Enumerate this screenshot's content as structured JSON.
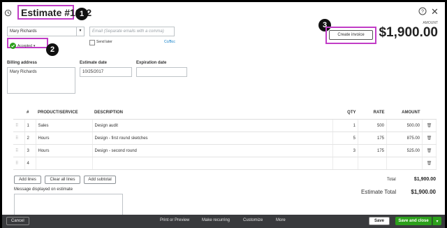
{
  "header": {
    "title": "Estimate #1002",
    "amount_label": "AMOUNT",
    "amount_value": "$1,900.00",
    "create_invoice": "Create invoice"
  },
  "callouts": [
    "1",
    "2",
    "3"
  ],
  "customer": {
    "name": "Mary Richards",
    "email_placeholder": "Email (Separate emails with a comma)",
    "cc_bcc": "Cc/Bcc",
    "send_later": "Send later",
    "status": "Accepted"
  },
  "billing": {
    "label": "Billing address",
    "value": "Mary Richards"
  },
  "dates": {
    "estimate_label": "Estimate date",
    "estimate_value": "10/25/2017",
    "expiration_label": "Expiration date",
    "expiration_value": ""
  },
  "table": {
    "columns": [
      "#",
      "PRODUCT/SERVICE",
      "DESCRIPTION",
      "QTY",
      "RATE",
      "AMOUNT"
    ],
    "rows": [
      {
        "n": "1",
        "product": "Sales",
        "description": "Design audit",
        "qty": "1",
        "rate": "500",
        "amount": "500.00"
      },
      {
        "n": "2",
        "product": "Hours",
        "description": "Design - first round sketches",
        "qty": "5",
        "rate": "175",
        "amount": "875.00"
      },
      {
        "n": "3",
        "product": "Hours",
        "description": "Design - second round",
        "qty": "3",
        "rate": "175",
        "amount": "525.00"
      },
      {
        "n": "4",
        "product": "",
        "description": "",
        "qty": "",
        "rate": "",
        "amount": ""
      }
    ]
  },
  "actions": {
    "add_lines": "Add lines",
    "clear_all": "Clear all lines",
    "add_subtotal": "Add subtotal"
  },
  "totals": {
    "total_label": "Total",
    "total_value": "$1,900.00",
    "estimate_total_label": "Estimate Total",
    "estimate_total_value": "$1,900.00"
  },
  "message_label": "Message displayed on estimate",
  "footer": {
    "cancel": "Cancel",
    "print_preview": "Print or Preview",
    "make_recurring": "Make recurring",
    "customize": "Customize",
    "more": "More",
    "save": "Save",
    "save_close": "Save and close"
  },
  "colors": {
    "accent_green": "#2ca01c",
    "callout": "#c13cc6",
    "footer_bg": "#393a3d"
  }
}
